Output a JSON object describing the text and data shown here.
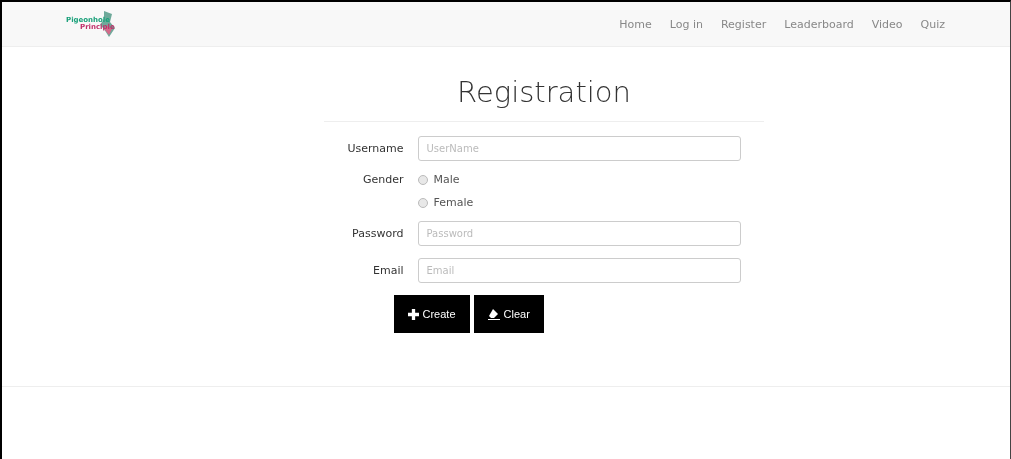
{
  "brand": {
    "line_1": "Pigeonhole",
    "line_2": "Principle"
  },
  "nav": [
    {
      "label": "Home"
    },
    {
      "label": "Log in"
    },
    {
      "label": "Register"
    },
    {
      "label": "Leaderboard"
    },
    {
      "label": "Video"
    },
    {
      "label": "Quiz"
    }
  ],
  "form": {
    "title": "Registration",
    "username": {
      "label": "Username",
      "placeholder": "UserName"
    },
    "gender": {
      "label": "Gender",
      "options": [
        {
          "label": "Male",
          "selected": false
        },
        {
          "label": "Female",
          "selected": false
        }
      ]
    },
    "password": {
      "label": "Password",
      "placeholder": "Password"
    },
    "email": {
      "label": "Email",
      "placeholder": "Email"
    },
    "buttons": [
      {
        "kind": "create",
        "label": "Create"
      },
      {
        "kind": "clear",
        "label": "Clear"
      }
    ]
  }
}
